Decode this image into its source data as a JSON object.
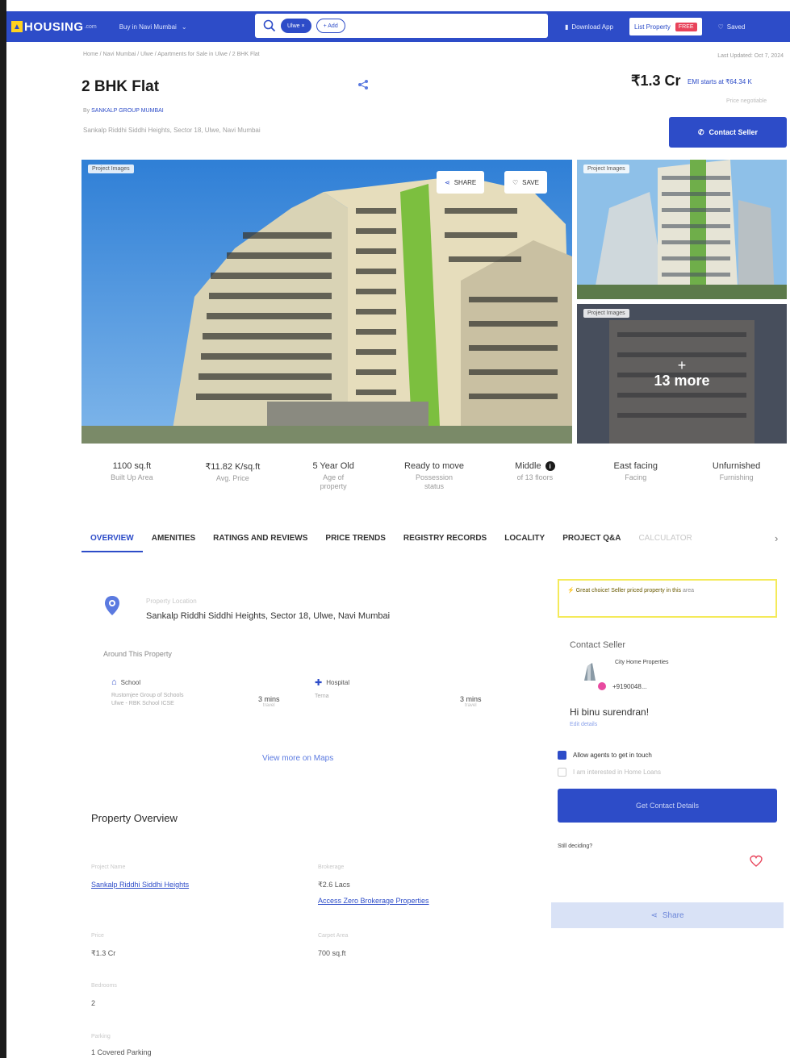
{
  "header": {
    "logo_text": "HOUSING",
    "logo_domain": ".com",
    "city_label": "Buy in Navi Mumbai",
    "search_chip": "Ulwe",
    "add_chip": "+ Add",
    "download_app": "Download App",
    "list_property": "List Property",
    "free_badge": "FREE",
    "saved": "Saved"
  },
  "breadcrumb": "Home / Navi Mumbai / Ulwe / Apartments for Sale in Ulwe / 2 BHK Flat",
  "last_updated": "Last Updated: Oct 7, 2024",
  "listing": {
    "title": "2 BHK Flat",
    "builder_prefix": "By",
    "builder_name": "SANKALP GROUP MUMBAI",
    "address": "Sankalp Riddhi Siddhi Heights, Sector 18, Ulwe, Navi Mumbai",
    "price": "₹1.3 Cr",
    "emi": "EMI starts at ₹64.34 K",
    "price_note": "Price negotiable",
    "contact_seller": "Contact Seller"
  },
  "gallery": {
    "tag": "Project Images",
    "share": "SHARE",
    "save": "SAVE",
    "more_plus": "+",
    "more_text": "13 more"
  },
  "stats": [
    {
      "value": "1100 sq.ft",
      "label": "Built Up Area"
    },
    {
      "value": "₹11.82 K/sq.ft",
      "label": "Avg. Price"
    },
    {
      "value": "5 Year Old",
      "label": "Age of property"
    },
    {
      "value": "Ready to move",
      "label": "Possession status"
    },
    {
      "value": "Middle",
      "label": "of 13 floors"
    },
    {
      "value": "East facing",
      "label": "Facing"
    },
    {
      "value": "Unfurnished",
      "label": "Furnishing"
    }
  ],
  "tabs": [
    "OVERVIEW",
    "AMENITIES",
    "RATINGS AND REVIEWS",
    "PRICE TRENDS",
    "REGISTRY RECORDS",
    "LOCALITY",
    "PROJECT Q&A",
    "CALCULATOR"
  ],
  "location": {
    "label": "Property Location",
    "value": "Sankalp Riddhi Siddhi Heights, Sector 18, Ulwe, Navi Mumbai",
    "around_title": "Around This Property",
    "pois": [
      {
        "type": "School",
        "name": "Rustomjee Group of Schools",
        "name2": "Ulwe - RBK School ICSE",
        "time": "3 mins",
        "mode": "travel"
      },
      {
        "type": "Hospital",
        "name": "Terna",
        "name2": "",
        "time": "3 mins",
        "mode": "travel"
      }
    ],
    "view_maps": "View more on Maps"
  },
  "overview": {
    "title": "Property Overview",
    "items": [
      {
        "label": "Project Name",
        "value": "Sankalp Riddhi Siddhi Heights"
      },
      {
        "label": "Brokerage",
        "value": "₹2.6 Lacs",
        "link": "Access Zero Brokerage Properties"
      },
      {
        "label": "Price",
        "value": "₹1.3 Cr"
      },
      {
        "label": "Carpet Area",
        "value": "700 sq.ft"
      },
      {
        "label": "Bedrooms",
        "value": "2"
      },
      {
        "label": "Parking",
        "value": "1 Covered Parking"
      }
    ]
  },
  "seller_panel": {
    "promo_strong": "Great choice! Seller priced property in this",
    "promo_rest": "area",
    "title": "Contact Seller",
    "name": "City Home Properties",
    "phone": "+9190048...",
    "greeting": "Hi binu surendran!",
    "edit": "Edit details",
    "allow_agents": "Allow agents to get in touch",
    "home_loans": "I am interested in Home Loans",
    "get_contact": "Get Contact Details",
    "still_deciding": "Still deciding?",
    "share": "Share"
  },
  "colors": {
    "brand": "#2d4cc8",
    "promo_border": "#f4ea5a",
    "badge": "#e8435a"
  }
}
